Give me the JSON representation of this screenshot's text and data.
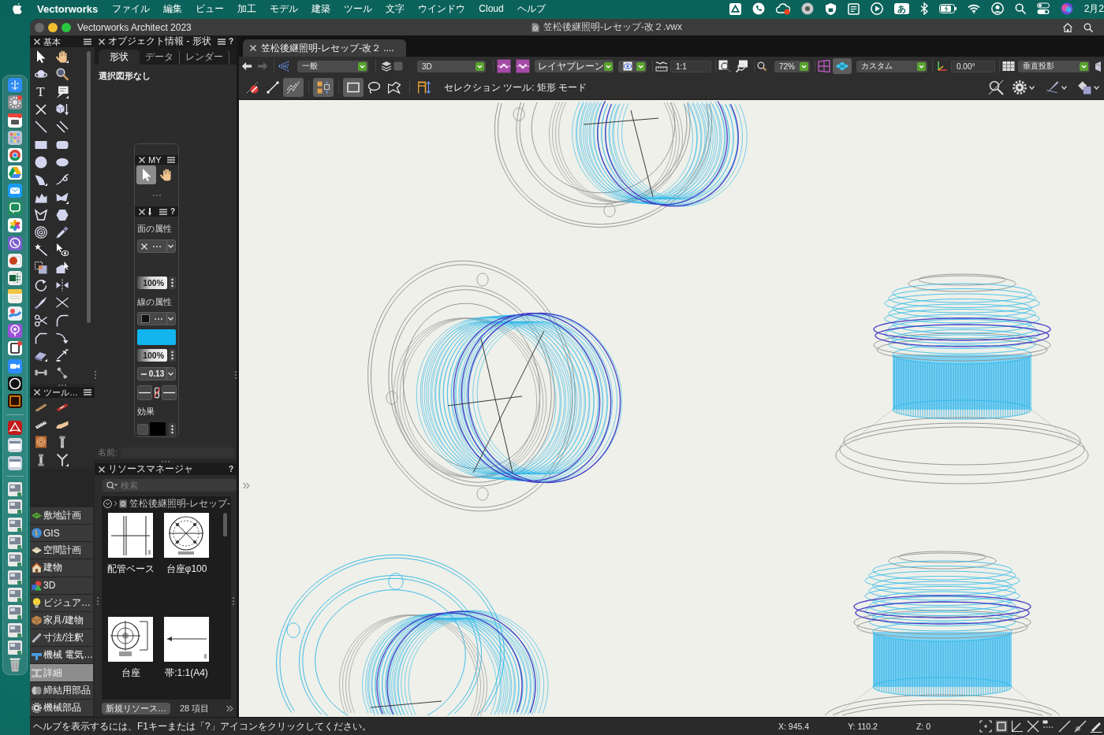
{
  "menu_bar": {
    "app_name": "Vectorworks",
    "menus": [
      "ファイル",
      "編集",
      "ビュー",
      "加工",
      "モデル",
      "建築",
      "ツール",
      "文字",
      "ウインドウ",
      "Cloud",
      "ヘルプ"
    ],
    "input_mode": "あ",
    "clock": "2月2"
  },
  "window": {
    "app_title": "Vectorworks Architect 2023",
    "document_title": "笠松後継照明-レセップ-改２.vwx"
  },
  "basic_palette": {
    "title": "基本",
    "text_tool_glyph": "T"
  },
  "tool_set_palette": {
    "title": "ツール…"
  },
  "workspace_list": [
    {
      "label": "敷地計画",
      "selected": false
    },
    {
      "label": "GIS",
      "selected": false
    },
    {
      "label": "空間計画",
      "selected": false
    },
    {
      "label": "建物",
      "selected": false
    },
    {
      "label": "3D",
      "selected": false
    },
    {
      "label": "ビジュア…",
      "selected": false
    },
    {
      "label": "家具/建物",
      "selected": false
    },
    {
      "label": "寸法/注釈",
      "selected": false
    },
    {
      "label": "機械 電気…",
      "selected": false
    },
    {
      "label": "詳細",
      "selected": true
    },
    {
      "label": "締結用部品",
      "selected": false
    },
    {
      "label": "機械部品",
      "selected": false
    }
  ],
  "object_info": {
    "title": "オブジェクト情報 - 形状",
    "help": "?",
    "tabs": [
      {
        "label": "形状",
        "selected": true
      },
      {
        "label": "データ",
        "selected": false
      },
      {
        "label": "レンダー",
        "selected": false
      }
    ],
    "message": "選択図形なし",
    "name_label": "名前:"
  },
  "my_palette": {
    "title": "MY",
    "tools": [
      {
        "selected": true
      },
      {
        "selected": false
      }
    ]
  },
  "attributes_palette": {
    "help": "?",
    "fill_heading": "面の属性",
    "fill_opacity": "100%",
    "pen_heading": "線の属性",
    "pen_opacity": "100%",
    "line_weight": "0.13",
    "effects_heading": "効果"
  },
  "resource_manager": {
    "title": "リソースマネージャ",
    "help": "?",
    "search": {
      "placeholder": "検索"
    },
    "path": "笠松後継照明-レセップ-",
    "resources": [
      {
        "label": "配管ベース"
      },
      {
        "label": "台座φ100"
      },
      {
        "label": "台座"
      },
      {
        "label": "帯:1:1(A4)"
      }
    ],
    "new_button": "新規リソース…",
    "count": "28 項目"
  },
  "document_tab": {
    "label": "笠松後継照明-レセップ-改２ ...."
  },
  "view_bar": {
    "back_disabled": false,
    "forward_disabled": true,
    "class": "一般",
    "view": "3D",
    "plane": "レイヤプレーン",
    "scale": "1:1",
    "zoom": "72%",
    "plane_mode_selected": true,
    "view_angle": "カスタム",
    "rotation": "0.00°",
    "projection": "垂直投影"
  },
  "mode_bar": {
    "buttons": [
      {
        "selected": false
      },
      {
        "selected": false
      },
      {
        "selected": true
      },
      {
        "selected": true
      },
      {
        "selected": true
      },
      {
        "selected": false
      },
      {
        "selected": false
      },
      {
        "selected": false
      }
    ],
    "label": "セレクション ツール: 矩形 モード"
  },
  "status_bar": {
    "help": "ヘルプを表示するには、F1キーまたは「?」アイコンをクリックしてください。",
    "x": "X: 945.4",
    "y": "Y: 110.2",
    "z": "Z: 0"
  }
}
